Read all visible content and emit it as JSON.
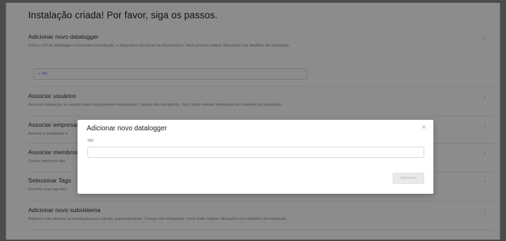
{
  "page": {
    "title": "Instalação criada! Por favor, siga os passos."
  },
  "sections": [
    {
      "title": "Adicionar novo datalogger",
      "description": "Insira o SN do datalogger conectado à instalação, o dispositivo irá enviar as informações. Você poderá realizar alterações nos detalhes da instalação.",
      "chevron": "chevron-down-icon"
    },
    {
      "title": "Associar usuários",
      "description": "Associar instalação ao usuário para seja possível visualização. Campo não obrigatório. Você pode realizar alterações nos detalhes da instalação.",
      "chevron": "chevron-right-icon"
    },
    {
      "title": "Associar empresas",
      "description": "Associe a Instalação à",
      "chevron": "chevron-right-icon"
    },
    {
      "title": "Associar membros",
      "description": "Outros membros são",
      "chevron": "chevron-right-icon"
    },
    {
      "title": "Selecionar Tags",
      "description": "Escolha uma tag relev",
      "chevron": "chevron-right-icon"
    },
    {
      "title": "Adicionar novo subsistema",
      "description": "Adicione sub-sistema na instalação para calcular separadamente. Campo não obrigatório. Você pode realizar alterações nos detalhes da instalação.",
      "chevron": "chevron-right-icon"
    }
  ],
  "sn_field": {
    "value": "+ SN"
  },
  "modal": {
    "title": "Adicionar novo datalogger",
    "close_glyph": "×",
    "field_label": "SN:",
    "field_value": "",
    "submit_label": "Adicionar"
  }
}
